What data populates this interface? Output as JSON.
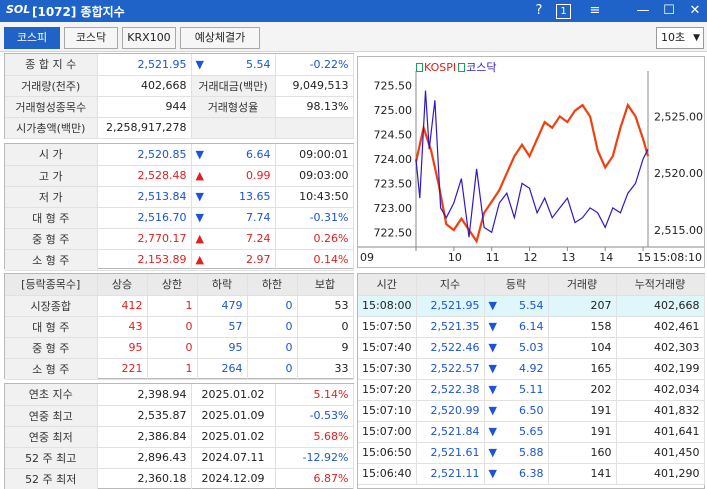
{
  "window": {
    "logo": "SOL",
    "title": "[1072] 종합지수",
    "help": "?",
    "page_num": "1",
    "menu": "≡",
    "minimize": "—",
    "maximize": "☐",
    "close": "✕"
  },
  "tabs": [
    {
      "label": "코스피",
      "active": true
    },
    {
      "label": "코스닥",
      "active": false
    },
    {
      "label": "KRX100",
      "active": false
    },
    {
      "label": "예상체결가",
      "active": false
    }
  ],
  "interval": {
    "value": "10초",
    "arrow": "▼"
  },
  "summary": {
    "index_label": "종 합 지 수",
    "index_value": "2,521.95",
    "index_arrow": "▼",
    "index_change": "5.54",
    "index_pct": "-0.22%",
    "volume_label": "거래량(천주)",
    "volume_value": "402,668",
    "amount_label": "거래대금(백만)",
    "amount_value": "9,049,513",
    "formed_label": "거래형성종목수",
    "formed_value": "944",
    "formed_rate_label": "거래형성율",
    "formed_rate_value": "98.13%",
    "mcap_label": "시가총액(백만)",
    "mcap_value": "2,258,917,278"
  },
  "prices": [
    {
      "label": "시  가",
      "value": "2,520.85",
      "arrow": "▼",
      "change": "6.64",
      "extra": "09:00:01",
      "color": "dn",
      "extra_color": ""
    },
    {
      "label": "고  가",
      "value": "2,528.48",
      "arrow": "▲",
      "change": "0.99",
      "extra": "09:03:00",
      "color": "up",
      "extra_color": ""
    },
    {
      "label": "저  가",
      "value": "2,513.84",
      "arrow": "▼",
      "change": "13.65",
      "extra": "10:43:50",
      "color": "dn",
      "extra_color": ""
    },
    {
      "label": "대 형 주",
      "value": "2,516.70",
      "arrow": "▼",
      "change": "7.74",
      "extra": "-0.31%",
      "color": "dn",
      "extra_color": "dn"
    },
    {
      "label": "중 형 주",
      "value": "2,770.17",
      "arrow": "▲",
      "change": "7.24",
      "extra": "0.26%",
      "color": "up",
      "extra_color": "up"
    },
    {
      "label": "소 형 주",
      "value": "2,153.89",
      "arrow": "▲",
      "change": "2.97",
      "extra": "0.14%",
      "color": "up",
      "extra_color": "up"
    }
  ],
  "breadth": {
    "headers": [
      "[등락종목수]",
      "상승",
      "상한",
      "하락",
      "하한",
      "보합"
    ],
    "rows": [
      {
        "label": "시장종합",
        "values": [
          "412",
          "1",
          "479",
          "0",
          "53"
        ]
      },
      {
        "label": "대 형 주",
        "values": [
          "43",
          "0",
          "57",
          "0",
          "0"
        ]
      },
      {
        "label": "중 형 주",
        "values": [
          "95",
          "0",
          "95",
          "0",
          "9"
        ]
      },
      {
        "label": "소 형 주",
        "values": [
          "221",
          "1",
          "264",
          "0",
          "33"
        ]
      }
    ]
  },
  "yearly": [
    {
      "label": "연초  지수",
      "value": "2,398.94",
      "date": "2025.01.02",
      "pct": "5.14%",
      "color": "up"
    },
    {
      "label": "연중  최고",
      "value": "2,535.87",
      "date": "2025.01.09",
      "pct": "-0.53%",
      "color": "dn"
    },
    {
      "label": "연중  최저",
      "value": "2,386.84",
      "date": "2025.01.02",
      "pct": "5.68%",
      "color": "up"
    },
    {
      "label": "52 주 최고",
      "value": "2,896.43",
      "date": "2024.07.11",
      "pct": "-12.92%",
      "color": "dn"
    },
    {
      "label": "52 주 최저",
      "value": "2,360.18",
      "date": "2024.12.09",
      "pct": "6.87%",
      "color": "up"
    }
  ],
  "ticks": {
    "headers": [
      "시간",
      "지수",
      "등락",
      "거래량",
      "누적거래량"
    ],
    "rows": [
      {
        "time": "15:08:00",
        "index": "2,521.95",
        "arrow": "▼",
        "change": "5.54",
        "volume": "207",
        "cum": "402,668"
      },
      {
        "time": "15:07:50",
        "index": "2,521.35",
        "arrow": "▼",
        "change": "6.14",
        "volume": "158",
        "cum": "402,461"
      },
      {
        "time": "15:07:40",
        "index": "2,522.46",
        "arrow": "▼",
        "change": "5.03",
        "volume": "104",
        "cum": "402,303"
      },
      {
        "time": "15:07:30",
        "index": "2,522.57",
        "arrow": "▼",
        "change": "4.92",
        "volume": "165",
        "cum": "402,199"
      },
      {
        "time": "15:07:20",
        "index": "2,522.38",
        "arrow": "▼",
        "change": "5.11",
        "volume": "202",
        "cum": "402,034"
      },
      {
        "time": "15:07:10",
        "index": "2,520.99",
        "arrow": "▼",
        "change": "6.50",
        "volume": "191",
        "cum": "401,832"
      },
      {
        "time": "15:07:00",
        "index": "2,521.84",
        "arrow": "▼",
        "change": "5.65",
        "volume": "191",
        "cum": "401,641"
      },
      {
        "time": "15:06:50",
        "index": "2,521.61",
        "arrow": "▼",
        "change": "5.88",
        "volume": "160",
        "cum": "401,450"
      },
      {
        "time": "15:06:40",
        "index": "2,521.11",
        "arrow": "▼",
        "change": "6.38",
        "volume": "141",
        "cum": "401,290"
      }
    ]
  },
  "chart_data": {
    "type": "line",
    "legend": [
      "KOSPI",
      "코스닥"
    ],
    "colors": {
      "kospi": "#f04010",
      "kosdaq": "#3018c8",
      "legend_box": "#19a25a"
    },
    "left_axis": {
      "ticks": [
        "725.50",
        "725.00",
        "724.50",
        "724.00",
        "723.50",
        "723.00",
        "722.50"
      ],
      "range": [
        722.2,
        725.8
      ]
    },
    "right_axis": {
      "ticks": [
        "2,525.00",
        "2,520.00",
        "2,515.00"
      ],
      "range": [
        2513.5,
        2529.0
      ]
    },
    "x_ticks": [
      "09",
      "10",
      "11",
      "12",
      "13",
      "14",
      "15"
    ],
    "x_last": "15:08:10",
    "series": [
      {
        "name": "KOSPI",
        "axis": "right",
        "t": [
          9.0,
          9.2,
          9.4,
          9.6,
          9.8,
          10.0,
          10.2,
          10.4,
          10.6,
          10.8,
          11.0,
          11.2,
          11.4,
          11.6,
          11.8,
          12.0,
          12.2,
          12.4,
          12.6,
          12.8,
          13.0,
          13.2,
          13.4,
          13.6,
          13.8,
          14.0,
          14.2,
          14.4,
          14.6,
          14.8,
          15.0,
          15.13
        ],
        "v": [
          2521.0,
          2524.0,
          2522.0,
          2519.0,
          2515.5,
          2515.0,
          2516.0,
          2515.0,
          2514.0,
          2516.5,
          2517.5,
          2518.5,
          2520.0,
          2521.5,
          2522.5,
          2521.5,
          2523.0,
          2524.5,
          2524.0,
          2525.0,
          2524.5,
          2525.5,
          2526.0,
          2525.0,
          2522.0,
          2520.5,
          2521.5,
          2524.0,
          2526.0,
          2525.0,
          2523.0,
          2521.5
        ]
      },
      {
        "name": "코스닥",
        "axis": "left",
        "t": [
          9.0,
          9.1,
          9.25,
          9.35,
          9.5,
          9.65,
          9.8,
          10.0,
          10.2,
          10.4,
          10.6,
          10.8,
          11.0,
          11.2,
          11.4,
          11.6,
          11.8,
          12.0,
          12.2,
          12.4,
          12.6,
          12.8,
          13.0,
          13.2,
          13.4,
          13.6,
          13.8,
          14.0,
          14.2,
          14.4,
          14.6,
          14.8,
          15.0,
          15.13
        ],
        "v": [
          724.0,
          723.2,
          725.4,
          724.2,
          725.2,
          723.0,
          722.8,
          723.1,
          723.6,
          722.4,
          723.8,
          722.6,
          722.5,
          723.1,
          723.3,
          722.8,
          723.5,
          723.4,
          722.9,
          723.2,
          722.8,
          723.0,
          723.2,
          722.7,
          722.8,
          723.0,
          722.9,
          722.6,
          723.0,
          722.9,
          723.3,
          723.5,
          724.0,
          724.2
        ]
      }
    ]
  }
}
